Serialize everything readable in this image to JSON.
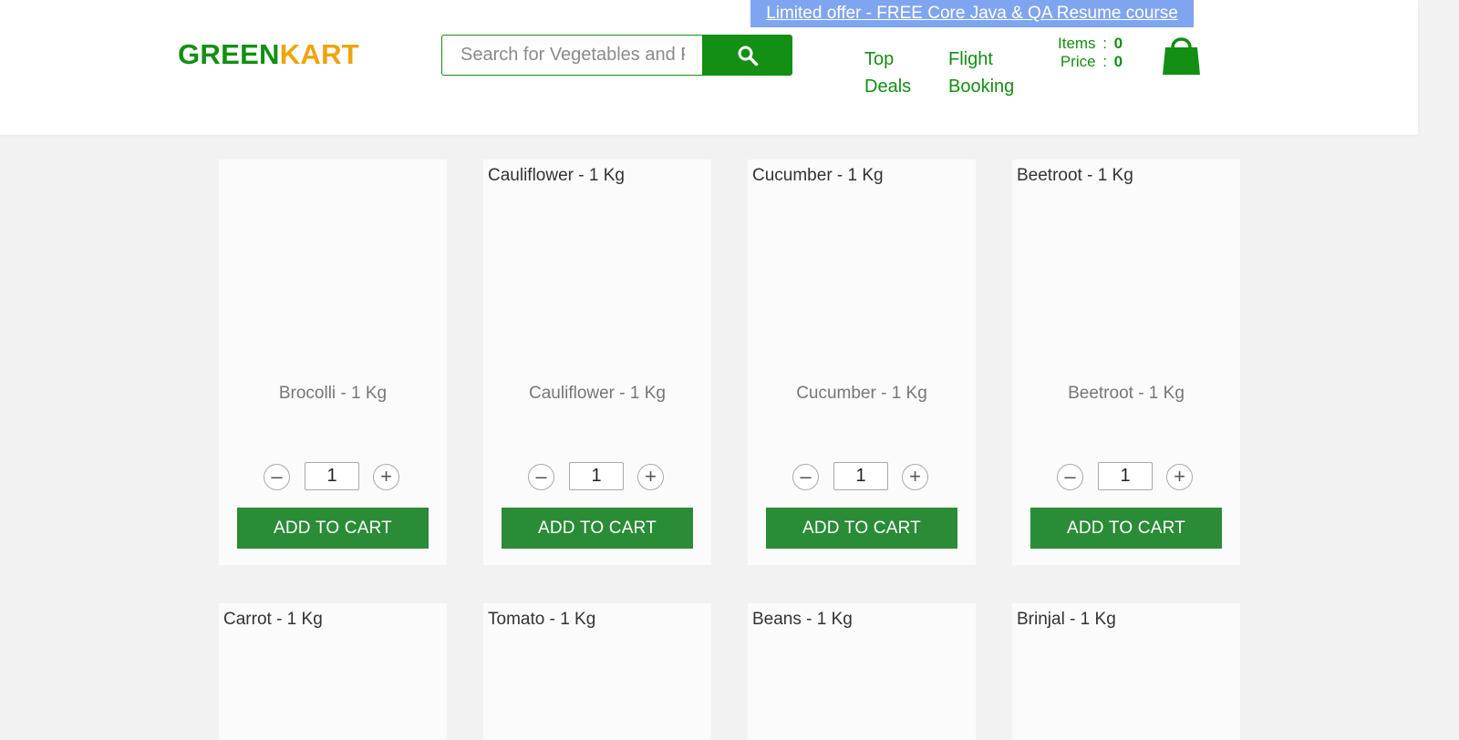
{
  "offer": {
    "text": "Limited offer - FREE Core Java & QA Resume course"
  },
  "logo": {
    "part1": "GREEN",
    "part2": "KART"
  },
  "search": {
    "placeholder": "Search for Vegetables and Fruits"
  },
  "nav": {
    "top_deals": "Top Deals",
    "flight_booking": "Flight Booking"
  },
  "cart": {
    "items_label": "Items",
    "items_value": "0",
    "price_label": "Price",
    "price_value": "0",
    "separator": ":"
  },
  "products": [
    {
      "top_name": "",
      "name": "Brocolli - 1 Kg",
      "qty": "1",
      "button": "ADD TO CART"
    },
    {
      "top_name": "Cauliflower - 1 Kg",
      "name": "Cauliflower - 1 Kg",
      "qty": "1",
      "button": "ADD TO CART"
    },
    {
      "top_name": "Cucumber - 1 Kg",
      "name": "Cucumber - 1 Kg",
      "qty": "1",
      "button": "ADD TO CART"
    },
    {
      "top_name": "Beetroot - 1 Kg",
      "name": "Beetroot - 1 Kg",
      "qty": "1",
      "button": "ADD TO CART"
    },
    {
      "top_name": "Carrot - 1 Kg"
    },
    {
      "top_name": "Tomato - 1 Kg"
    },
    {
      "top_name": "Beans - 1 Kg"
    },
    {
      "top_name": "Brinjal - 1 Kg"
    }
  ],
  "colors": {
    "brand_green": "#138f13",
    "brand_orange": "#f0a30a",
    "button_green": "#2a8c36",
    "offer_blue": "#7fa5f0"
  },
  "icons": {
    "search": "search-icon",
    "cart": "cart-bag-icon",
    "minus": "minus-icon",
    "plus": "plus-icon"
  }
}
